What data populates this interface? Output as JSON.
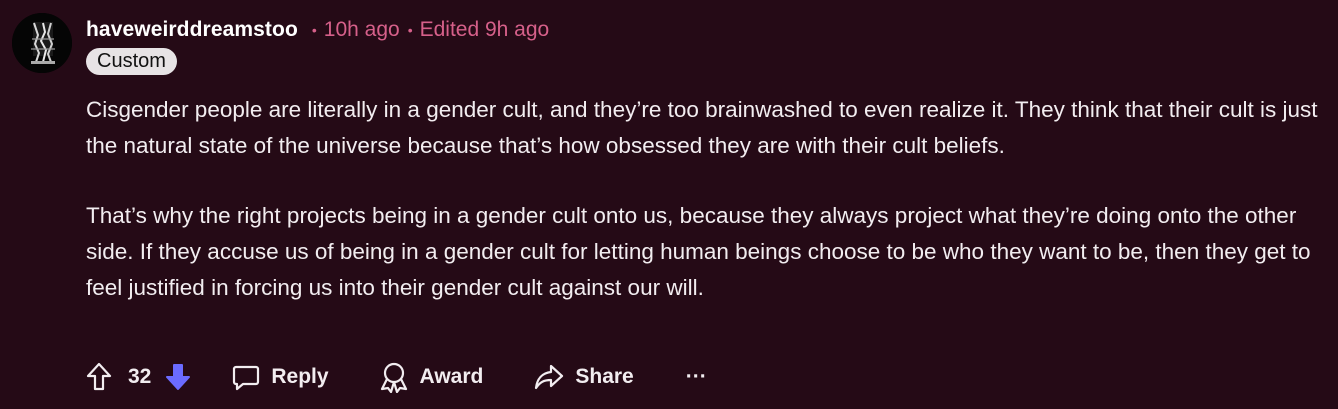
{
  "comment": {
    "username": "haveweirddreamstoo",
    "time": "10h ago",
    "edited": "Edited 9h ago",
    "flair": "Custom",
    "paragraphs": [
      "Cisgender people are literally in a gender cult, and they’re too brainwashed to even realize it. They think that their cult is just the natural state of the universe because that’s how obsessed they are with their cult beliefs.",
      "That’s why the right projects being in a gender cult onto us, because they always project what they’re doing onto the other side. If they accuse us of being in a gender cult for letting human beings choose to be who they want to be, then they get to feel justified in forcing us into their gender cult against our will."
    ]
  },
  "actions": {
    "vote_count": "32",
    "downvote_active": true,
    "downvote_color": "#6b6bff",
    "reply_label": "Reply",
    "award_label": "Award",
    "share_label": "Share",
    "more_label": "···"
  },
  "colors": {
    "background": "#250a16",
    "meta_pink": "#d6608a"
  }
}
